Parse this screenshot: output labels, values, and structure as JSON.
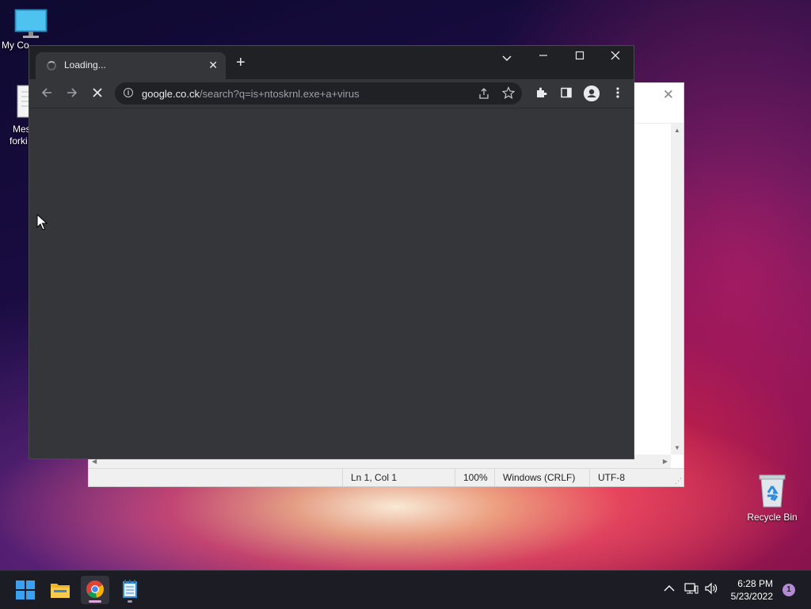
{
  "desktop": {
    "icons": [
      {
        "label": "My Co"
      },
      {
        "label_line1": "Mes",
        "label_line2": "forki"
      },
      {
        "label": "Recycle Bin"
      }
    ]
  },
  "notepad": {
    "status": {
      "position": "Ln 1, Col 1",
      "zoom": "100%",
      "line_ending": "Windows (CRLF)",
      "encoding": "UTF-8"
    }
  },
  "chrome": {
    "tab": {
      "title": "Loading..."
    },
    "omnibox": {
      "host": "google.co.ck",
      "path": "/search?q=is+ntoskrnl.exe+a+virus"
    },
    "page_background": "#35363a"
  },
  "taskbar": {
    "apps": [
      "start-button",
      "file-explorer",
      "chrome",
      "notepad"
    ],
    "clock": {
      "time": "6:28 PM",
      "date": "5/23/2022"
    },
    "notification_count": "1",
    "indicator_color": "#dfa6d8"
  }
}
